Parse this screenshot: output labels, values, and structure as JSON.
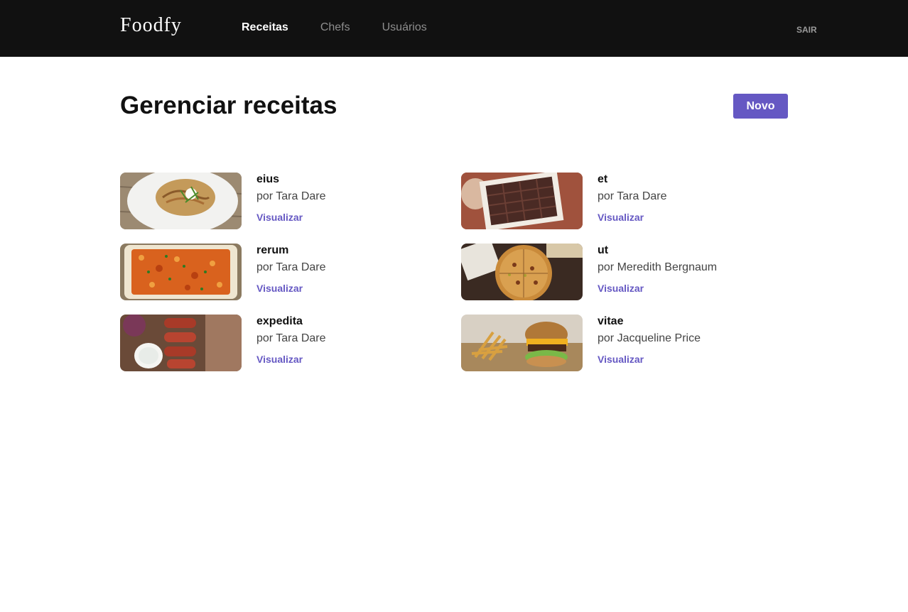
{
  "header": {
    "logo": "Foodfy",
    "nav": [
      {
        "label": "Receitas",
        "active": true
      },
      {
        "label": "Chefs",
        "active": false
      },
      {
        "label": "Usuários",
        "active": false
      }
    ],
    "logout_label": "SAIR"
  },
  "main": {
    "title": "Gerenciar receitas",
    "new_button_label": "Novo",
    "recipes": [
      {
        "title": "eius",
        "author": "por Tara Dare",
        "link_label": "Visualizar",
        "image": "spaghetti-photo"
      },
      {
        "title": "et",
        "author": "por Tara Dare",
        "link_label": "Visualizar",
        "image": "chocolate-box-photo"
      },
      {
        "title": "rerum",
        "author": "por Tara Dare",
        "link_label": "Visualizar",
        "image": "baked-pasta-photo"
      },
      {
        "title": "ut",
        "author": "por Meredith Bergnaum",
        "link_label": "Visualizar",
        "image": "pizza-photo"
      },
      {
        "title": "expedita",
        "author": "por Tara Dare",
        "link_label": "Visualizar",
        "image": "sausages-photo"
      },
      {
        "title": "vitae",
        "author": "por Jacqueline Price",
        "link_label": "Visualizar",
        "image": "burger-fries-photo"
      }
    ]
  },
  "colors": {
    "header_bg": "#111111",
    "accent": "#6558c3",
    "nav_inactive": "#8e8e8e"
  }
}
